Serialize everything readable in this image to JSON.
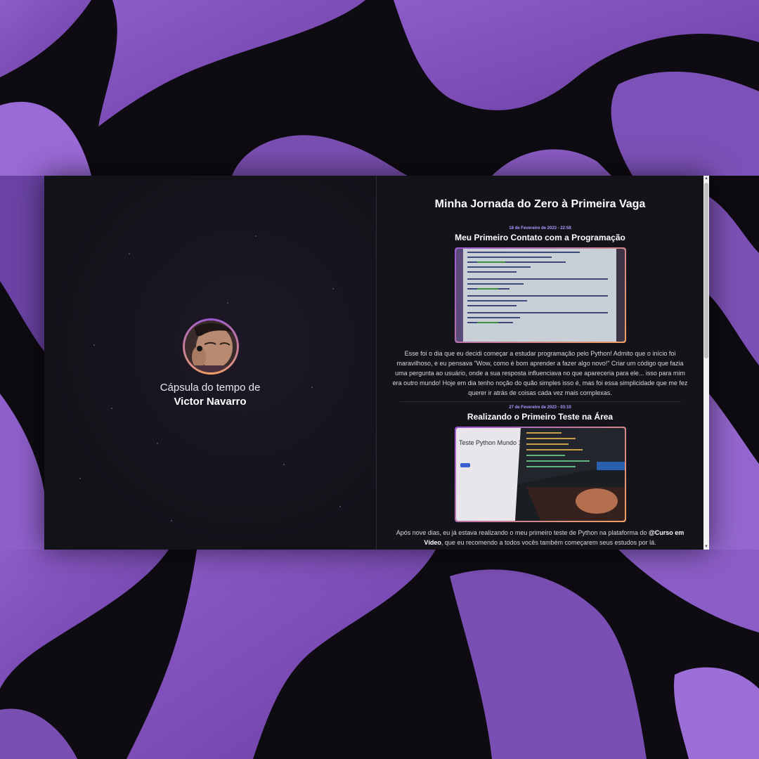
{
  "colors": {
    "accent_purple": "#9b59d6",
    "accent_orange": "#f0a060",
    "date_color": "#a89cff",
    "panel_bg": "#141219"
  },
  "profile": {
    "capsule_prefix": "Cápsula do tempo de",
    "name": "Victor Navarro",
    "avatar_icon": "user-photo-avatar"
  },
  "timeline": {
    "title": "Minha Jornada do Zero à Primeira Vaga",
    "posts": [
      {
        "date": "18 de Fevereiro de 2023 - 22:58",
        "title": "Meu Primeiro Contato com a Programação",
        "image_desc": "python-terminal-photo",
        "text": "Esse foi o dia que eu decidi começar a estudar programação pelo Python! Admito que o início foi maravilhoso, e eu pensava \"Wow, como é bom aprender a fazer algo novo!\" Criar um código que fazia uma pergunta ao usuário, onde a sua resposta influenciava no que apareceria para ele... isso para mim era outro mundo! Hoje em dia tenho noção do quão simples isso é, mas foi essa simplicidade que me fez querer ir atrás de coisas cada vez mais complexas."
      },
      {
        "date": "27 de Fevereiro de 2023 - 03:10",
        "title": "Realizando o Primeiro Teste na Área",
        "image_desc": "python-test-screen-photo",
        "image_caption": "Teste Python Mundo 1",
        "text_before": "Após nove dias, eu já estava realizando o meu primeiro teste de Python na plataforma do ",
        "text_bold": "@Curso em Vídeo",
        "text_after": ", que eu recomendo a todos vocês também começarem seus estudos por lá."
      }
    ]
  }
}
